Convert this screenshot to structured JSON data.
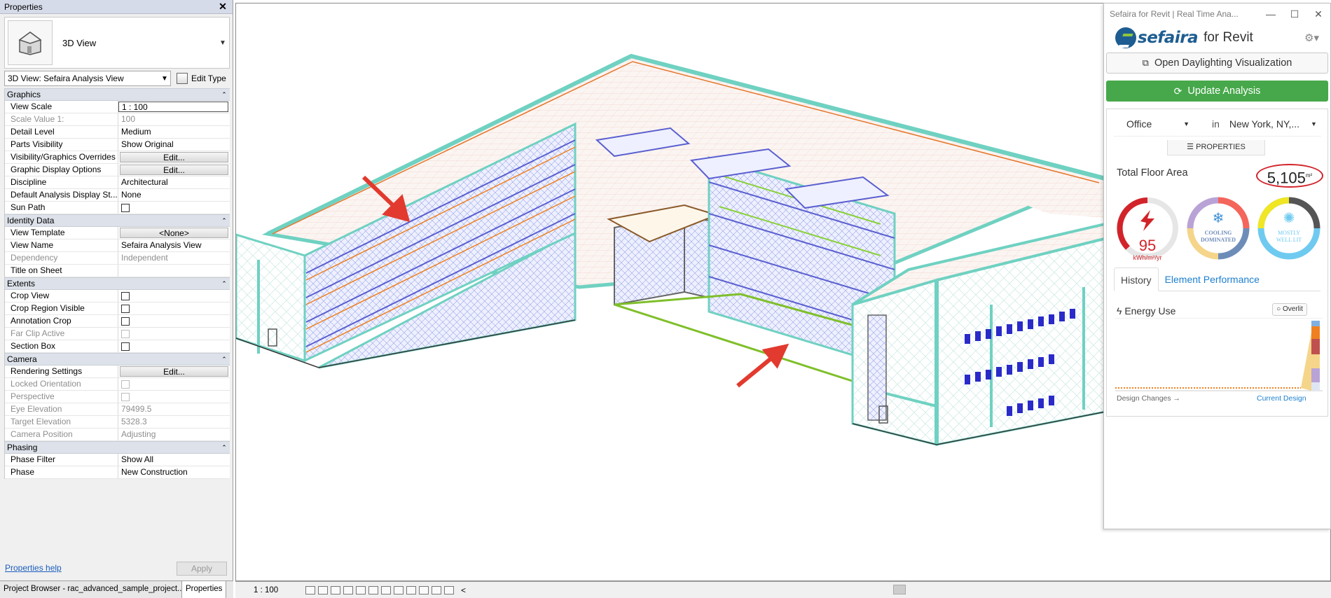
{
  "properties": {
    "title": "Properties",
    "type_name": "3D View",
    "instance_selector": "3D View: Sefaira Analysis View",
    "edit_type_label": "Edit Type",
    "groups": [
      {
        "name": "Graphics",
        "rows": [
          {
            "key": "View Scale",
            "value": "1 : 100",
            "kind": "boxed"
          },
          {
            "key": "Scale Value    1:",
            "value": "100",
            "kind": "text",
            "disabled": true
          },
          {
            "key": "Detail Level",
            "value": "Medium",
            "kind": "text"
          },
          {
            "key": "Parts Visibility",
            "value": "Show Original",
            "kind": "text"
          },
          {
            "key": "Visibility/Graphics Overrides",
            "value": "Edit...",
            "kind": "button"
          },
          {
            "key": "Graphic Display Options",
            "value": "Edit...",
            "kind": "button"
          },
          {
            "key": "Discipline",
            "value": "Architectural",
            "kind": "text"
          },
          {
            "key": "Default Analysis Display St...",
            "value": "None",
            "kind": "text"
          },
          {
            "key": "Sun Path",
            "value": "",
            "kind": "checkbox"
          }
        ]
      },
      {
        "name": "Identity Data",
        "rows": [
          {
            "key": "View Template",
            "value": "<None>",
            "kind": "button"
          },
          {
            "key": "View Name",
            "value": "Sefaira Analysis View",
            "kind": "text"
          },
          {
            "key": "Dependency",
            "value": "Independent",
            "kind": "text",
            "disabled": true
          },
          {
            "key": "Title on Sheet",
            "value": "",
            "kind": "text"
          }
        ]
      },
      {
        "name": "Extents",
        "rows": [
          {
            "key": "Crop View",
            "value": "",
            "kind": "checkbox"
          },
          {
            "key": "Crop Region Visible",
            "value": "",
            "kind": "checkbox"
          },
          {
            "key": "Annotation Crop",
            "value": "",
            "kind": "checkbox"
          },
          {
            "key": "Far Clip Active",
            "value": "",
            "kind": "checkbox",
            "disabled": true
          },
          {
            "key": "Section Box",
            "value": "",
            "kind": "checkbox"
          }
        ]
      },
      {
        "name": "Camera",
        "rows": [
          {
            "key": "Rendering Settings",
            "value": "Edit...",
            "kind": "button"
          },
          {
            "key": "Locked Orientation",
            "value": "",
            "kind": "checkbox",
            "disabled": true
          },
          {
            "key": "Perspective",
            "value": "",
            "kind": "checkbox",
            "disabled": true
          },
          {
            "key": "Eye Elevation",
            "value": "79499.5",
            "kind": "text",
            "disabled": true
          },
          {
            "key": "Target Elevation",
            "value": "5328.3",
            "kind": "text",
            "disabled": true
          },
          {
            "key": "Camera Position",
            "value": "Adjusting",
            "kind": "text",
            "disabled": true
          }
        ]
      },
      {
        "name": "Phasing",
        "rows": [
          {
            "key": "Phase Filter",
            "value": "Show All",
            "kind": "text"
          },
          {
            "key": "Phase",
            "value": "New Construction",
            "kind": "text"
          }
        ]
      }
    ],
    "help_link": "Properties help",
    "apply_label": "Apply"
  },
  "bottom_tabs": [
    "Project Browser - rac_advanced_sample_project....",
    "Properties"
  ],
  "statusbar": {
    "scale": "1 : 100"
  },
  "sefaira": {
    "window_title": "Sefaira for Revit | Real Time Ana...",
    "logo_text": "sefaira",
    "logo_suffix": "for Revit",
    "open_daylighting": "Open Daylighting Visualization",
    "update_analysis": "Update Analysis",
    "building_type": "Office",
    "in_label": "in",
    "location": "New York, NY,...",
    "properties_tab": "PROPERTIES",
    "total_floor_area_label": "Total Floor Area",
    "total_floor_area_value": "5,105",
    "total_floor_area_unit": "m²",
    "eui_value": "95",
    "eui_unit": "kWh/m²/yr",
    "cooling_label_1": "COOLING",
    "cooling_label_2": "DOMINATED",
    "daylight_label_1": "MOSTLY",
    "daylight_label_2": "WELL LIT",
    "tabs": [
      "History",
      "Element Performance"
    ],
    "energy_use_label": "Energy Use",
    "overlit_label": "Overlit",
    "design_changes_label": "Design Changes →",
    "current_design_label": "Current Design",
    "colors": {
      "green": "#46a84a",
      "red": "#d2232a",
      "blue": "#1d5d91",
      "teal": "#5ecfbf",
      "orange": "#f0801f"
    }
  }
}
